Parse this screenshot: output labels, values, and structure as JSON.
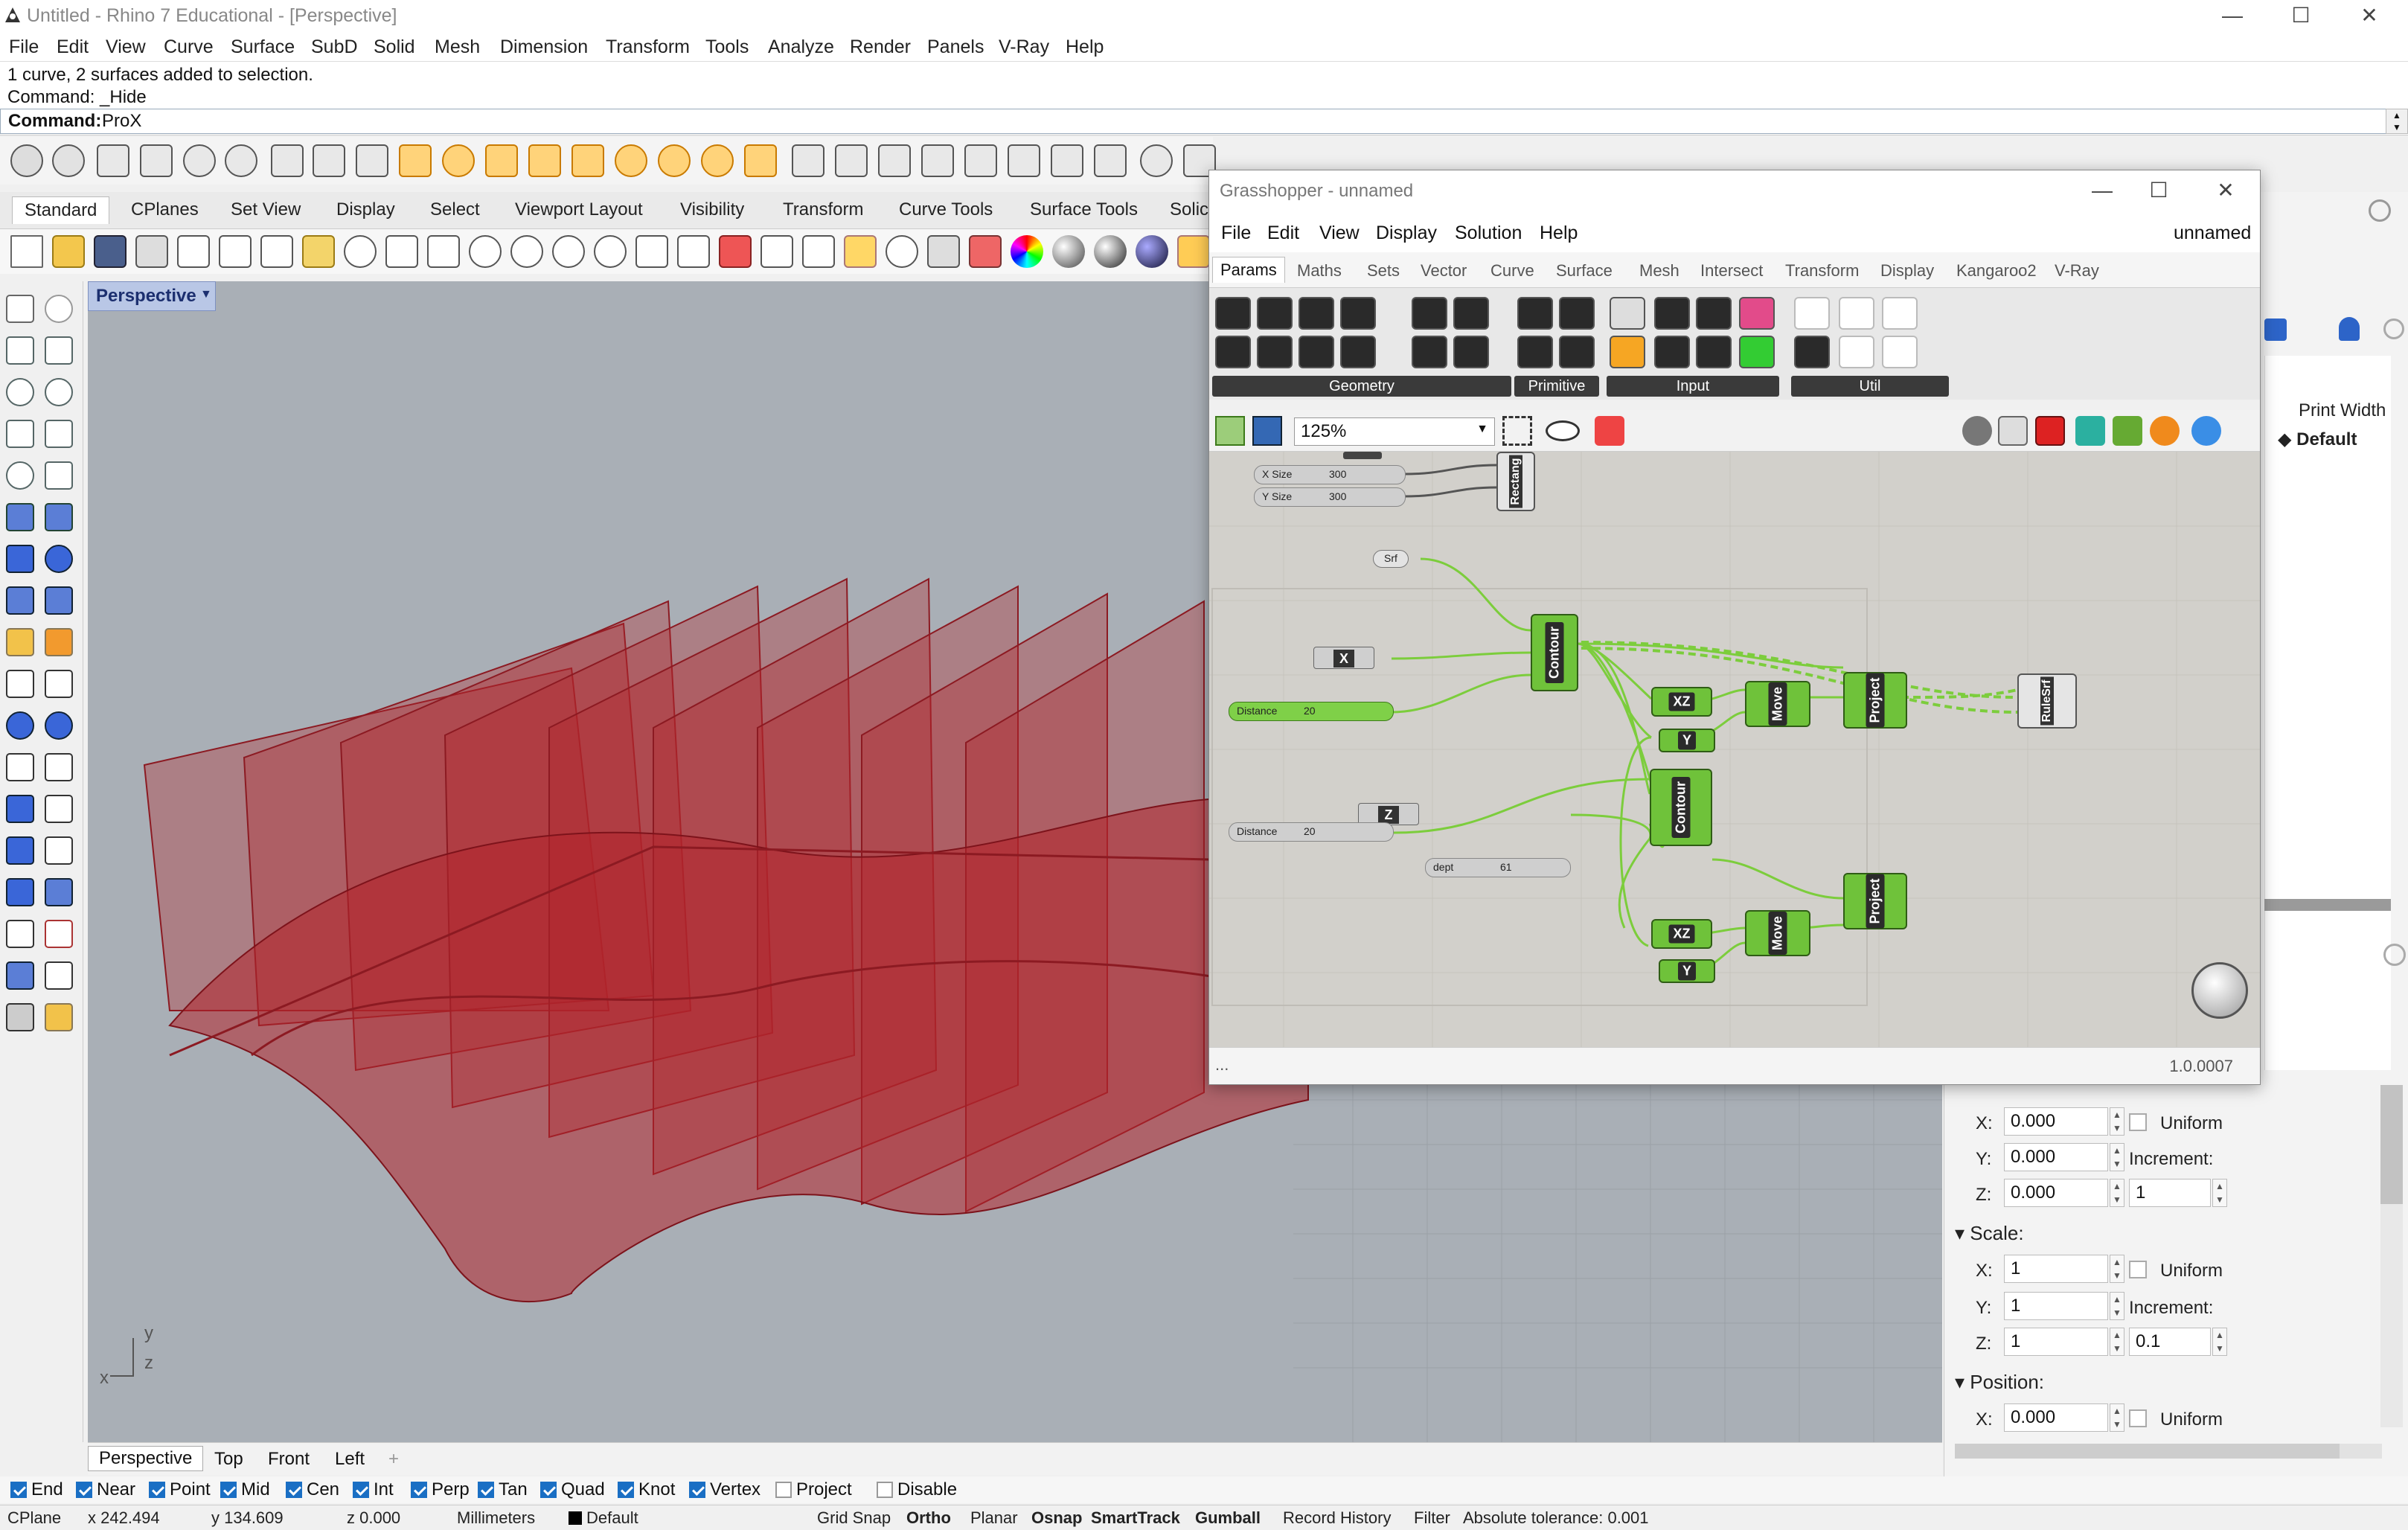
{
  "window": {
    "title": "Untitled - Rhino 7 Educational - [Perspective]",
    "controls": {
      "minimize": "—",
      "maximize": "☐",
      "close": "✕"
    }
  },
  "menu": [
    "File",
    "Edit",
    "View",
    "Curve",
    "Surface",
    "SubD",
    "Solid",
    "Mesh",
    "Dimension",
    "Transform",
    "Tools",
    "Analyze",
    "Render",
    "Panels",
    "V-Ray",
    "Help"
  ],
  "command": {
    "history": [
      "1 curve, 2 surfaces added to selection.",
      "Command: _Hide"
    ],
    "prompt_label": "Command:",
    "prompt_value": "ProX"
  },
  "toolbar_tabs": [
    "Standard",
    "CPlanes",
    "Set View",
    "Display",
    "Select",
    "Viewport Layout",
    "Visibility",
    "Transform",
    "Curve Tools",
    "Surface Tools",
    "Solic"
  ],
  "viewport": {
    "title": "Perspective",
    "axes": {
      "x": "x",
      "y": "y",
      "z": "z"
    },
    "tabs": [
      "Perspective",
      "Top",
      "Front",
      "Left"
    ],
    "add_tab": "+"
  },
  "osnaps": [
    {
      "label": "End",
      "checked": true
    },
    {
      "label": "Near",
      "checked": true
    },
    {
      "label": "Point",
      "checked": true
    },
    {
      "label": "Mid",
      "checked": true
    },
    {
      "label": "Cen",
      "checked": true
    },
    {
      "label": "Int",
      "checked": true
    },
    {
      "label": "Perp",
      "checked": true
    },
    {
      "label": "Tan",
      "checked": true
    },
    {
      "label": "Quad",
      "checked": true
    },
    {
      "label": "Knot",
      "checked": true
    },
    {
      "label": "Vertex",
      "checked": true
    },
    {
      "label": "Project",
      "checked": false
    },
    {
      "label": "Disable",
      "checked": false
    }
  ],
  "status": {
    "cplane": "CPlane",
    "x": "x 242.494",
    "y": "y 134.609",
    "z": "z 0.000",
    "units": "Millimeters",
    "layer": "Default",
    "grid_snap": "Grid Snap",
    "ortho": "Ortho",
    "planar": "Planar",
    "osnap": "Osnap",
    "smarttrack": "SmartTrack",
    "gumball": "Gumball",
    "record_history": "Record History",
    "filter": "Filter",
    "tolerance": "Absolute tolerance: 0.001"
  },
  "right_panel": {
    "print_width_label": "Print Width",
    "print_width_value": "Default",
    "rotation": {
      "x": "0.000",
      "y": "0.000",
      "z": "0.000",
      "uniform": "Uniform",
      "increment_label": "Increment:",
      "increment": "1"
    },
    "scale": {
      "title": "Scale:",
      "x": "1",
      "y": "1",
      "z": "1",
      "uniform": "Uniform",
      "increment_label": "Increment:",
      "increment": "0.1"
    },
    "position": {
      "title": "Position:",
      "x": "0.000",
      "uniform": "Uniform"
    },
    "axis_labels": {
      "x": "X:",
      "y": "Y:",
      "z": "Z:"
    }
  },
  "grasshopper": {
    "title": "Grasshopper - unnamed",
    "menu": [
      "File",
      "Edit",
      "View",
      "Display",
      "Solution",
      "Help"
    ],
    "doc_name": "unnamed",
    "tabs": [
      "Params",
      "Maths",
      "Sets",
      "Vector",
      "Curve",
      "Surface",
      "Mesh",
      "Intersect",
      "Transform",
      "Display",
      "Kangaroo2",
      "V-Ray"
    ],
    "ribbon_groups": [
      "Geometry",
      "Primitive",
      "Input",
      "Util"
    ],
    "zoom": "125%",
    "version": "1.0.0007",
    "footer_dots": "...",
    "canvas": {
      "sliders": [
        {
          "name": "X Size",
          "value": "300"
        },
        {
          "name": "Y Size",
          "value": "300"
        },
        {
          "name": "Distance",
          "value": "20"
        },
        {
          "name": "Distance",
          "value": "20"
        },
        {
          "name": "dept",
          "value": "61"
        }
      ],
      "params": [
        "Srf"
      ],
      "components": [
        "Rectang",
        "Contour",
        "Contour",
        "RuleSrf",
        "Project",
        "Project",
        "Move",
        "Move",
        "XZ",
        "XZ"
      ],
      "vectors": [
        "X",
        "Z",
        "Y",
        "Y"
      ]
    }
  }
}
